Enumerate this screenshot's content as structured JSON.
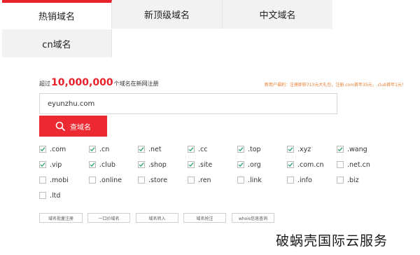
{
  "tabs": {
    "hot": "热销域名",
    "newtld": "新顶级域名",
    "chinese": "中文域名",
    "cn": "cn域名"
  },
  "stats": {
    "prefix": "超过",
    "count": "10,000,000",
    "suffix": "个域名在新网注册"
  },
  "promo": "新用户福利：注册即获713元大礼包，注册.com首年35元，.club首年1元！",
  "search": {
    "value": "eyunzhu.com",
    "button_label": "查域名"
  },
  "tlds": [
    {
      "label": ".com",
      "checked": true
    },
    {
      "label": ".cn",
      "checked": true
    },
    {
      "label": ".net",
      "checked": true
    },
    {
      "label": ".cc",
      "checked": true
    },
    {
      "label": ".top",
      "checked": true
    },
    {
      "label": ".xyz",
      "checked": true
    },
    {
      "label": ".wang",
      "checked": true
    },
    {
      "label": ".vip",
      "checked": true
    },
    {
      "label": ".club",
      "checked": true
    },
    {
      "label": ".shop",
      "checked": true
    },
    {
      "label": ".site",
      "checked": true
    },
    {
      "label": ".org",
      "checked": true
    },
    {
      "label": ".com.cn",
      "checked": true
    },
    {
      "label": ".net.cn",
      "checked": false
    },
    {
      "label": ".mobi",
      "checked": false
    },
    {
      "label": ".online",
      "checked": false
    },
    {
      "label": ".store",
      "checked": false
    },
    {
      "label": ".ren",
      "checked": false
    },
    {
      "label": ".link",
      "checked": false
    },
    {
      "label": ".info",
      "checked": false
    },
    {
      "label": ".biz",
      "checked": false
    },
    {
      "label": ".ltd",
      "checked": false
    }
  ],
  "actions": {
    "bulk_register": "域名批量注册",
    "fixed_price": "一口价域名",
    "transfer_in": "域名转入",
    "auction": "域名抢注",
    "whois": "whois信息查询"
  },
  "watermark": "破蜗壳国际云服务",
  "colors": {
    "accent": "#e8212b",
    "button": "#ec2932",
    "promo": "#e87a2a",
    "tab_bg": "#f2f2f2"
  }
}
